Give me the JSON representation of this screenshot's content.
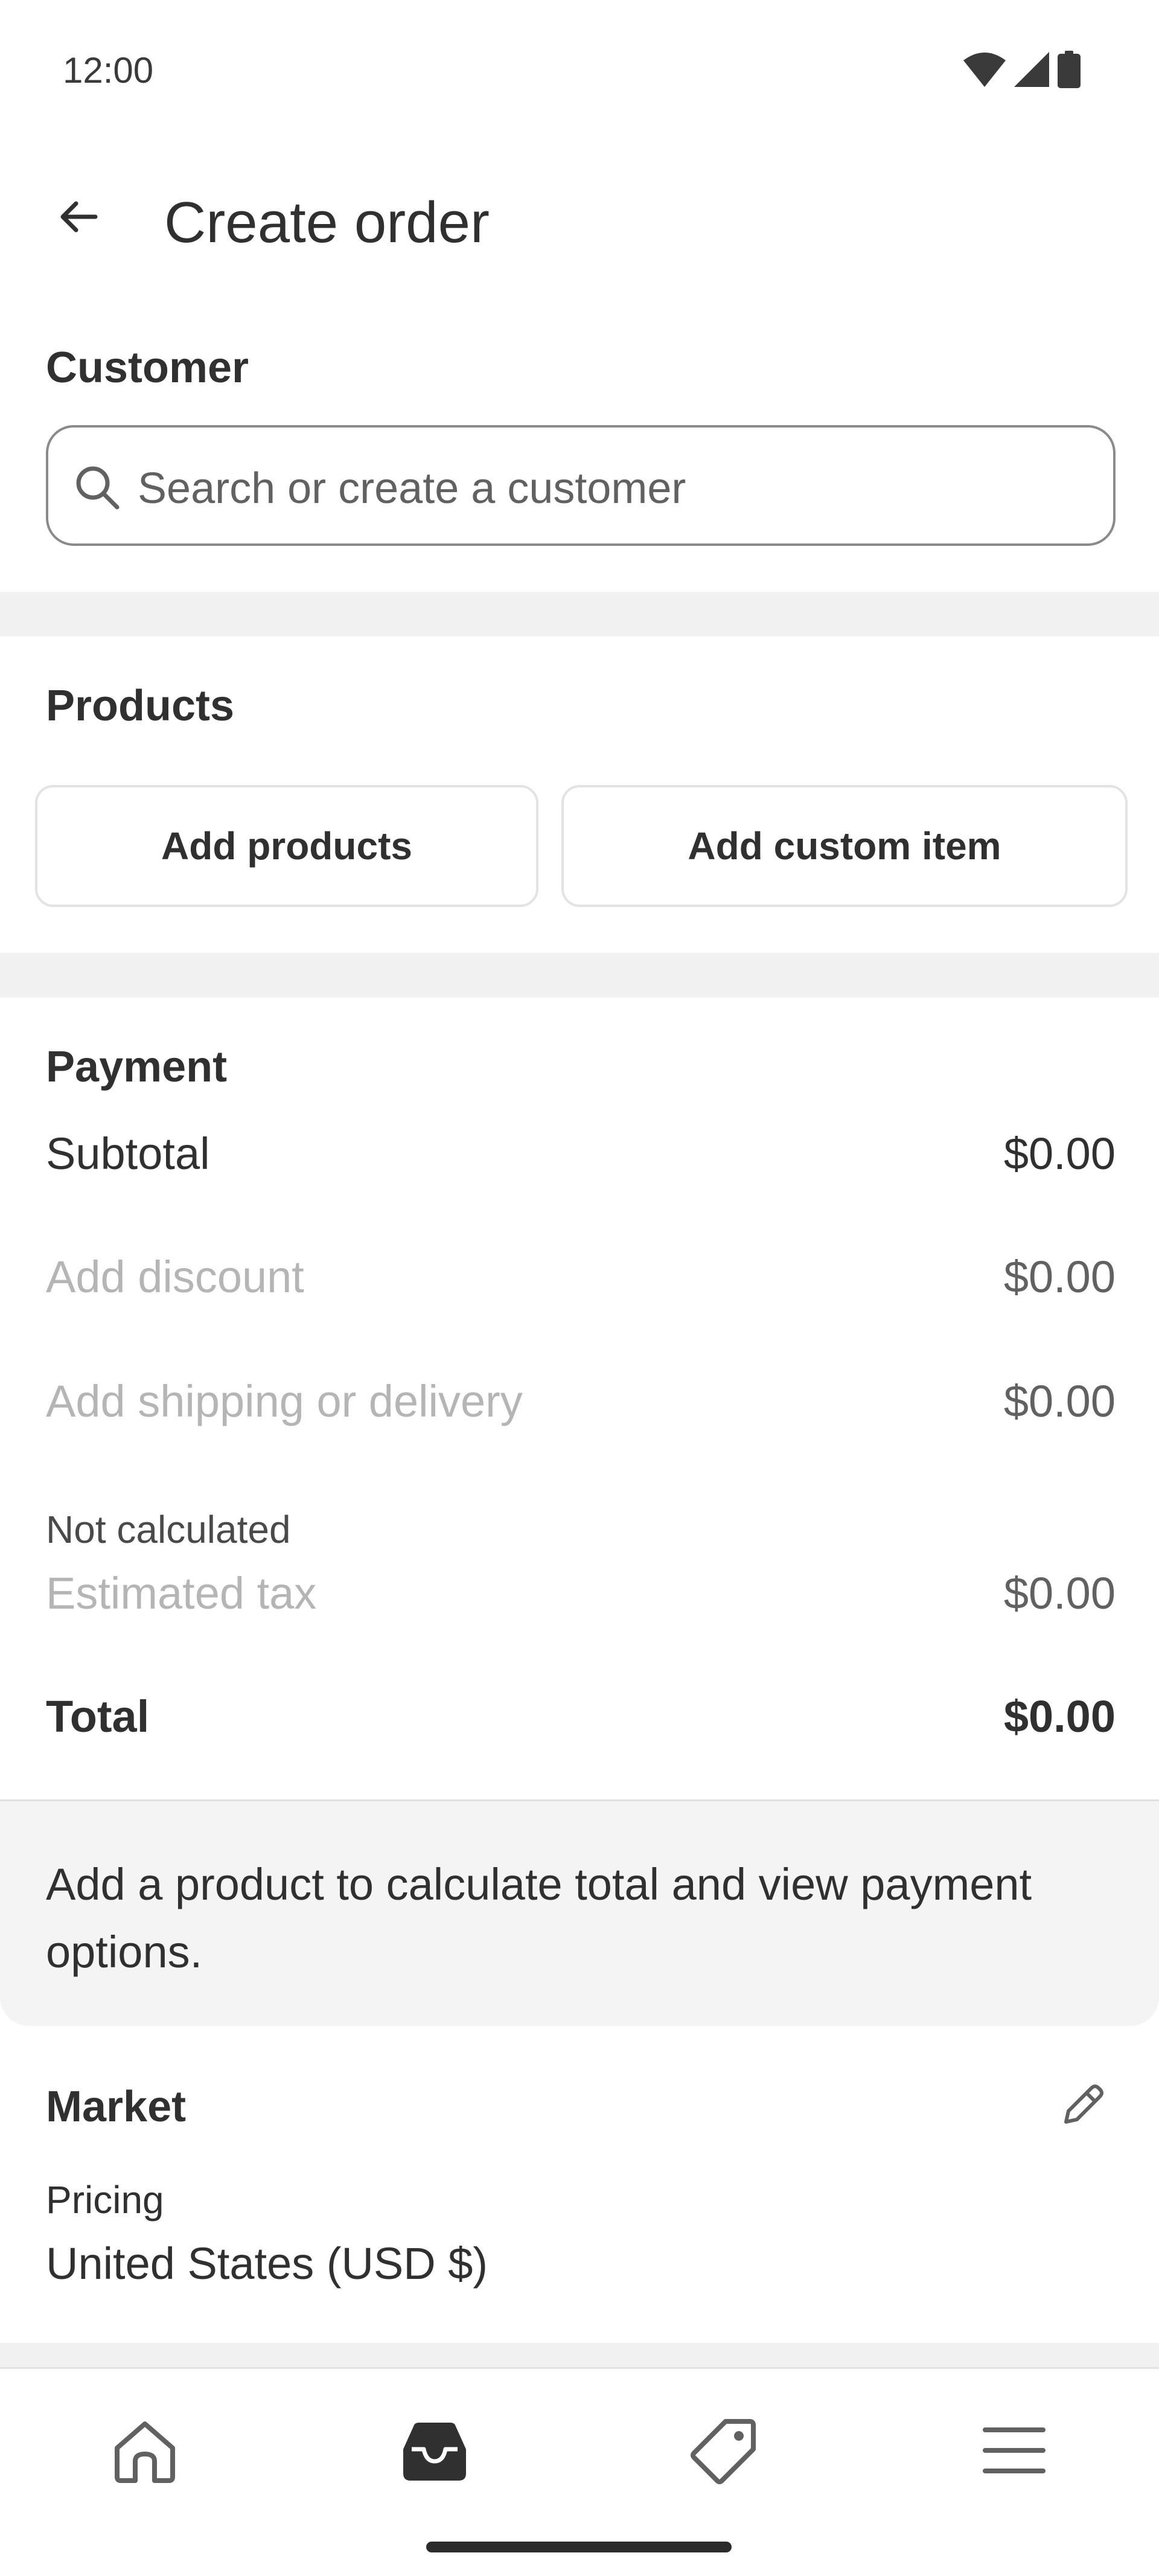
{
  "status_bar": {
    "time": "12:00"
  },
  "header": {
    "title": "Create order"
  },
  "customer": {
    "label": "Customer",
    "search_placeholder": "Search or create a customer"
  },
  "products": {
    "label": "Products",
    "add_products": "Add products",
    "add_custom_item": "Add custom item"
  },
  "payment": {
    "label": "Payment",
    "subtotal": {
      "label": "Subtotal",
      "value": "$0.00"
    },
    "discount": {
      "label": "Add discount",
      "value": "$0.00"
    },
    "shipping": {
      "label": "Add shipping or delivery",
      "value": "$0.00"
    },
    "tax_note": "Not calculated",
    "tax": {
      "label": "Estimated tax",
      "value": "$0.00"
    },
    "total": {
      "label": "Total",
      "value": "$0.00"
    },
    "hint": "Add a product to calculate total and view payment options."
  },
  "market": {
    "label": "Market",
    "pricing_label": "Pricing",
    "pricing_value": "United States (USD $)"
  },
  "bottom_nav": {
    "items": [
      "home-icon",
      "orders-icon",
      "products-tag-icon",
      "menu-icon"
    ],
    "active": "orders-icon"
  },
  "colors": {
    "text": "#303030",
    "muted": "#b5b5b5",
    "band": "#f1f1f1",
    "border": "#8a8a8a"
  }
}
